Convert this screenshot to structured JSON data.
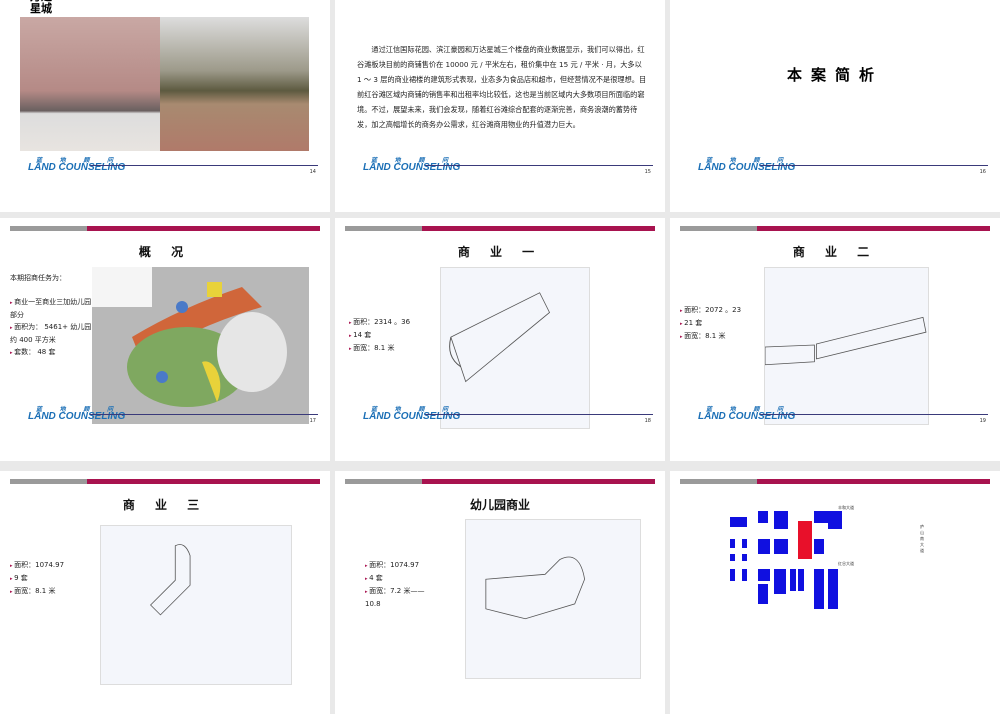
{
  "logo": {
    "cn": "蓝 地 顾 问",
    "en": "LAND COUNSELING"
  },
  "slides": [
    {
      "num": "14",
      "title": "万达星城"
    },
    {
      "num": "15",
      "body": "通过江信国际花园、滨江豪园和万达星城三个楼盘的商业数据显示，我们可以得出，红谷滩板块目前的商铺售价在 10000 元 / 平米左右，租价集中在 15 元 / 平米 · 月，大多以 1 ～ 3 层的商业裙楼的建筑形式表现，业态多为食品店和超市，但经营情况不是很理想。目前红谷滩区域内商铺的销售率和出租率均比较低，这也是当前区域内大多数项目所面临的窘境。不过，展望未来，我们会发现，随着红谷滩综合配套的逐渐完善，商务浪潮的蓄势待发，加之高幅增长的商务办公需求，红谷滩商用物业的升值潜力巨大。"
    },
    {
      "num": "16",
      "title": "本案简析"
    },
    {
      "num": "17",
      "title": "概 况",
      "intro": "本期招商任务为：",
      "bullets": [
        "商业一至商业三加幼儿园部分",
        "面积为： 5461+ 幼儿园约 400 平方米",
        "套数： 48 套"
      ]
    },
    {
      "num": "18",
      "title": "商 业 一",
      "bullets": [
        "面积：2314 。36",
        "14 套",
        "面宽：8.1 米"
      ]
    },
    {
      "num": "19",
      "title": "商 业 二",
      "bullets": [
        "面积：2072 。23",
        "21 套",
        "面宽：8.1 米"
      ]
    },
    {
      "title": "商 业 三",
      "bullets": [
        "面积：1074.97",
        "9 套",
        "面宽：8.1 米"
      ]
    },
    {
      "title": "幼儿园商业",
      "bullets": [
        "面积：1074.97",
        "4 套",
        "面宽：7.2 米——10.8"
      ]
    },
    {
      "map_labels": [
        "丰和大道",
        "红谷大道",
        "庐山南大道"
      ]
    }
  ],
  "colors": {
    "accent": "#a8134f",
    "gray": "#9a9a9a",
    "map_blue": "#1010e0",
    "map_red": "#e8102a"
  }
}
